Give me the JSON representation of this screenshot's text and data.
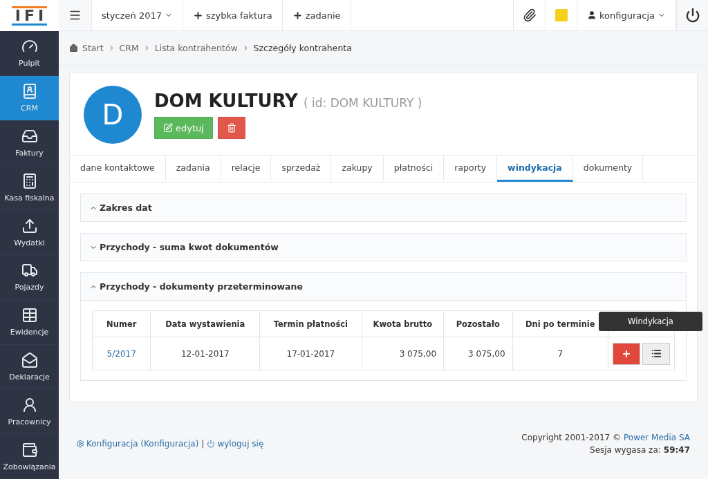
{
  "logo": "IFI",
  "topbar": {
    "period": "styczeń 2017",
    "actions": [
      "szybka faktura",
      "zadanie"
    ],
    "user": "konfiguracja"
  },
  "sidebar": {
    "items": [
      {
        "label": "Pulpit",
        "selected": false
      },
      {
        "label": "CRM",
        "selected": true
      },
      {
        "label": "Faktury",
        "selected": false
      },
      {
        "label": "Kasa fiskalna",
        "selected": false
      },
      {
        "label": "Wydatki",
        "selected": false
      },
      {
        "label": "Pojazdy",
        "selected": false
      },
      {
        "label": "Ewidencje",
        "selected": false
      },
      {
        "label": "Deklaracje",
        "selected": false
      },
      {
        "label": "Pracownicy",
        "selected": false
      },
      {
        "label": "Zobowiązania",
        "selected": false
      }
    ]
  },
  "breadcrumb": [
    "Start",
    "CRM",
    "Lista kontrahentów",
    "Szczegóły kontrahenta"
  ],
  "contractor": {
    "initial": "D",
    "name": "DOM KULTURY",
    "id_text": "( id: DOM KULTURY )",
    "edit_label": "edytuj"
  },
  "tabs": [
    {
      "label": "dane kontaktowe",
      "selected": false
    },
    {
      "label": "zadania",
      "selected": false
    },
    {
      "label": "relacje",
      "selected": false
    },
    {
      "label": "sprzedaż",
      "selected": false
    },
    {
      "label": "zakupy",
      "selected": false
    },
    {
      "label": "płatności",
      "selected": false
    },
    {
      "label": "raporty",
      "selected": false
    },
    {
      "label": "windykacja",
      "selected": true
    },
    {
      "label": "dokumenty",
      "selected": false
    }
  ],
  "sections": [
    {
      "title": "Zakres dat",
      "expanded": true
    },
    {
      "title": "Przychody - suma kwot dokumentów",
      "expanded": false
    },
    {
      "title": "Przychody - dokumenty przeterminowane",
      "expanded": true,
      "table": {
        "columns": [
          "Numer",
          "Data wystawienia",
          "Termin płatności",
          "Kwota brutto",
          "Pozostało",
          "Dni po terminie"
        ],
        "rows": [
          {
            "number": "5/2017",
            "issued": "12-01-2017",
            "due": "17-01-2017",
            "gross": "3 075,00",
            "remaining": "3 075,00",
            "days": "7"
          }
        ],
        "tooltip": "Windykacja"
      }
    }
  ],
  "footer": {
    "config_link": "Konfiguracja (Konfiguracja)",
    "separator": "|",
    "logout": "wyloguj się",
    "copyright": "Copyright 2001-2017 ©",
    "company": "Power Media SA",
    "session_label": "Sesja wygasa za:",
    "session_time": "59:47"
  }
}
